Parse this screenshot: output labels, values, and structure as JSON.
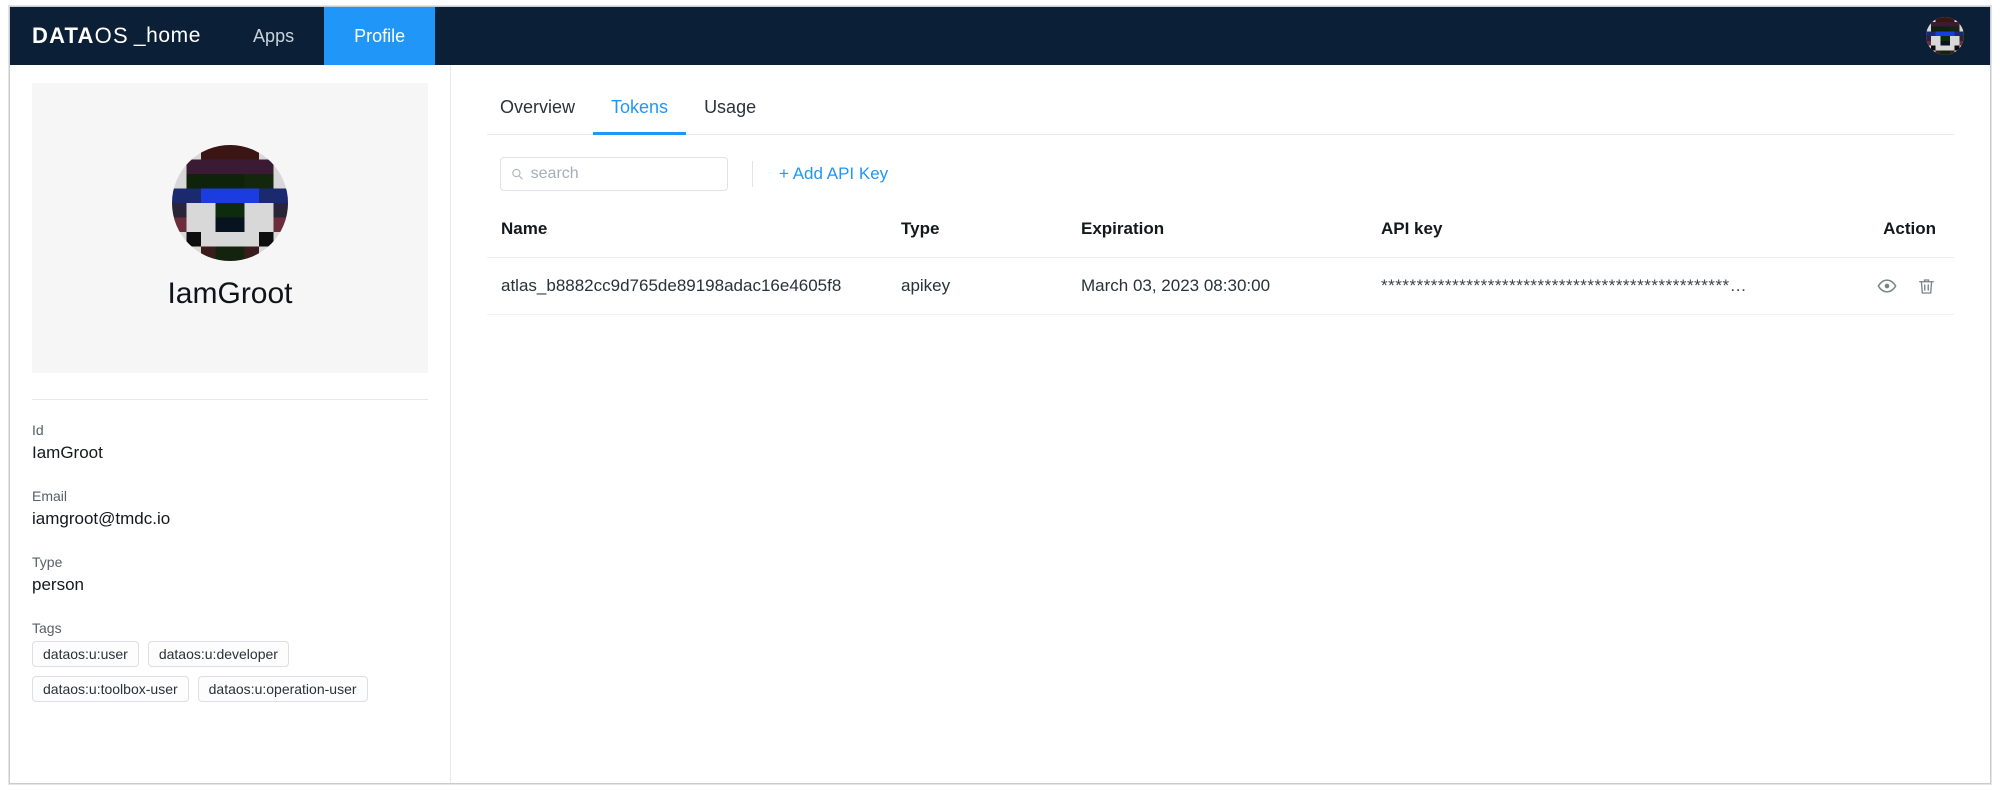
{
  "topbar": {
    "brand_bold": "DATA",
    "brand_light": "OS",
    "brand_suffix": "_home",
    "nav": [
      {
        "label": "Apps",
        "active": false
      },
      {
        "label": "Profile",
        "active": true
      }
    ],
    "avatar_name": "user-avatar"
  },
  "sidebar": {
    "profile_name": "IamGroot",
    "fields": [
      {
        "label": "Id",
        "value": "IamGroot"
      },
      {
        "label": "Email",
        "value": "iamgroot@tmdc.io"
      },
      {
        "label": "Type",
        "value": "person"
      }
    ],
    "tags_label": "Tags",
    "tags": [
      "dataos:u:user",
      "dataos:u:developer",
      "dataos:u:toolbox-user",
      "dataos:u:operation-user"
    ]
  },
  "main": {
    "tabs": [
      {
        "label": "Overview",
        "active": false
      },
      {
        "label": "Tokens",
        "active": true
      },
      {
        "label": "Usage",
        "active": false
      }
    ],
    "search": {
      "value": "",
      "placeholder": "search"
    },
    "add_api_key_label": "+ Add API Key",
    "table": {
      "headers": [
        "Name",
        "Type",
        "Expiration",
        "API key",
        "Action"
      ],
      "rows": [
        {
          "name": "atlas_b8882cc9d765de89198adac16e4605f8",
          "type": "apikey",
          "expiration": "March 03, 2023 08:30:00",
          "api_key": "*************************************************…",
          "actions": [
            "eye-icon",
            "trash-icon"
          ]
        }
      ]
    }
  },
  "colors": {
    "topbar_bg": "#0b1f36",
    "accent": "#2196f9",
    "card_bg": "#f6f6f7",
    "border": "#e6e8ea"
  }
}
